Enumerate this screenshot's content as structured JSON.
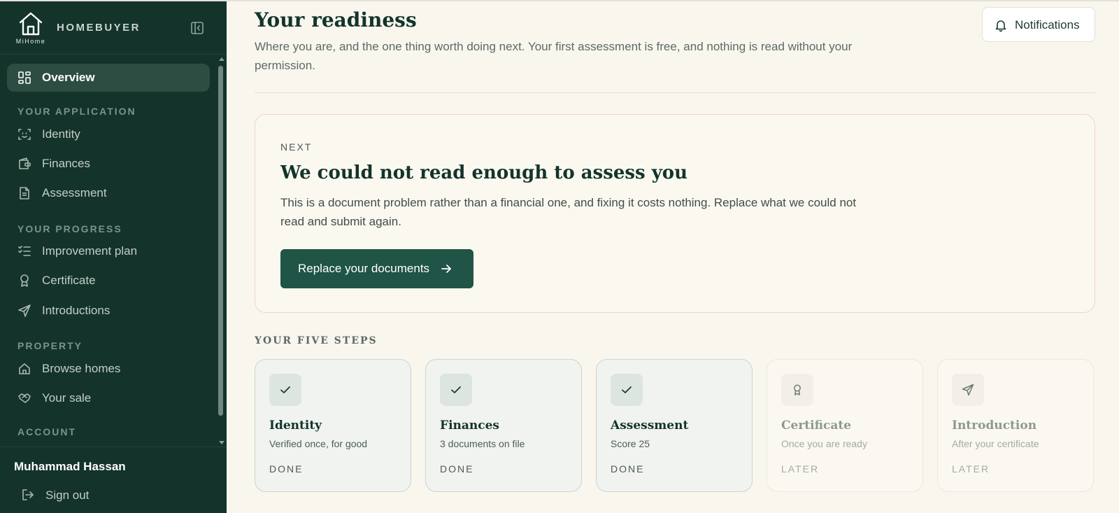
{
  "brand": {
    "logo_text": "MiHome",
    "name": "HOMEBUYER"
  },
  "nav": {
    "overview": "Overview",
    "sections": {
      "application": "YOUR APPLICATION",
      "progress": "YOUR PROGRESS",
      "property": "PROPERTY",
      "account": "ACCOUNT"
    },
    "items": {
      "identity": "Identity",
      "finances": "Finances",
      "assessment": "Assessment",
      "improvement": "Improvement plan",
      "certificate": "Certificate",
      "introductions": "Introductions",
      "browse": "Browse homes",
      "sale": "Your sale"
    }
  },
  "user": {
    "name": "Muhammad Hassan",
    "signout": "Sign out"
  },
  "header": {
    "title": "Your readiness",
    "subtitle": "Where you are, and the one thing worth doing next. Your first assessment is free, and nothing is read without your permission.",
    "notifications": "Notifications"
  },
  "next": {
    "eyebrow": "NEXT",
    "title": "We could not read enough to assess you",
    "body": "This is a document problem rather than a financial one, and fixing it costs nothing. Replace what we could not read and submit again.",
    "button": "Replace your documents"
  },
  "steps": {
    "heading": "YOUR FIVE STEPS",
    "items": [
      {
        "title": "Identity",
        "desc": "Verified once, for good",
        "status": "DONE",
        "icon": "check-icon"
      },
      {
        "title": "Finances",
        "desc": "3 documents on file",
        "status": "DONE",
        "icon": "check-icon"
      },
      {
        "title": "Assessment",
        "desc": "Score 25",
        "status": "DONE",
        "icon": "check-icon"
      },
      {
        "title": "Certificate",
        "desc": "Once you are ready",
        "status": "LATER",
        "icon": "award-icon"
      },
      {
        "title": "Introduction",
        "desc": "After your certificate",
        "status": "LATER",
        "icon": "send-icon"
      }
    ]
  },
  "colors": {
    "sidebar_bg": "#14332a",
    "accent": "#1f5446",
    "page_bg": "#f9f6ee",
    "title_text": "#13342a"
  }
}
